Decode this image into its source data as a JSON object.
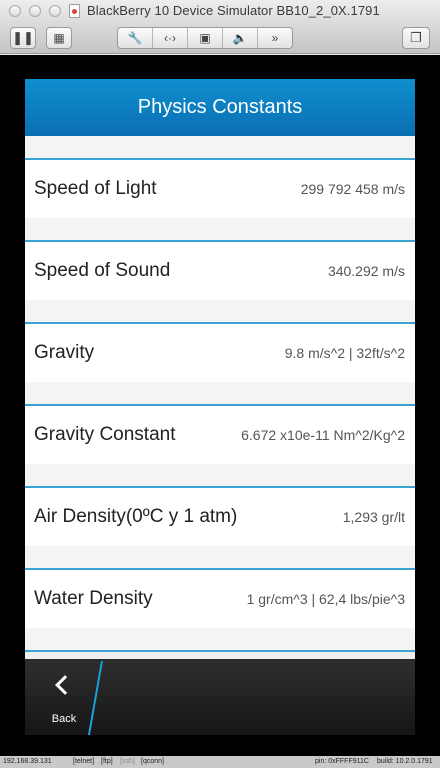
{
  "window": {
    "title": "BlackBerry 10 Device Simulator BB10_2_0X.1791"
  },
  "app": {
    "header_title": "Physics Constants"
  },
  "constants": [
    {
      "name": "Speed of Light",
      "value": "299 792 458 m/s"
    },
    {
      "name": "Speed of Sound",
      "value": "340.292 m/s"
    },
    {
      "name": "Gravity",
      "value": "9.8 m/s^2 | 32ft/s^2"
    },
    {
      "name": "Gravity Constant",
      "value": "6.672 x10e-11 Nm^2/Kg^2"
    },
    {
      "name": "Air Density(0ºC y 1 atm)",
      "value": "1,293 gr/lt"
    },
    {
      "name": "Water Density",
      "value": "1 gr/cm^3 | 62,4 lbs/pie^3"
    }
  ],
  "actionbar": {
    "back_label": "Back",
    "accent_color": "#1aa0dc"
  },
  "statusbar": {
    "ip": "192.168.39.131",
    "telnet": "[telnet]",
    "ftp": "[ftp]",
    "ssh": "[ssh]",
    "qconn": "[qconn]",
    "pin": "pin: 0xFFFF911C",
    "build": "build: 10.2.0.1791"
  },
  "icons": [
    "pause-icon",
    "screenshot-icon",
    "wrench-icon",
    "arrows-icon",
    "sd-card-icon",
    "volume-icon",
    "fast-forward-icon",
    "window-icon"
  ]
}
